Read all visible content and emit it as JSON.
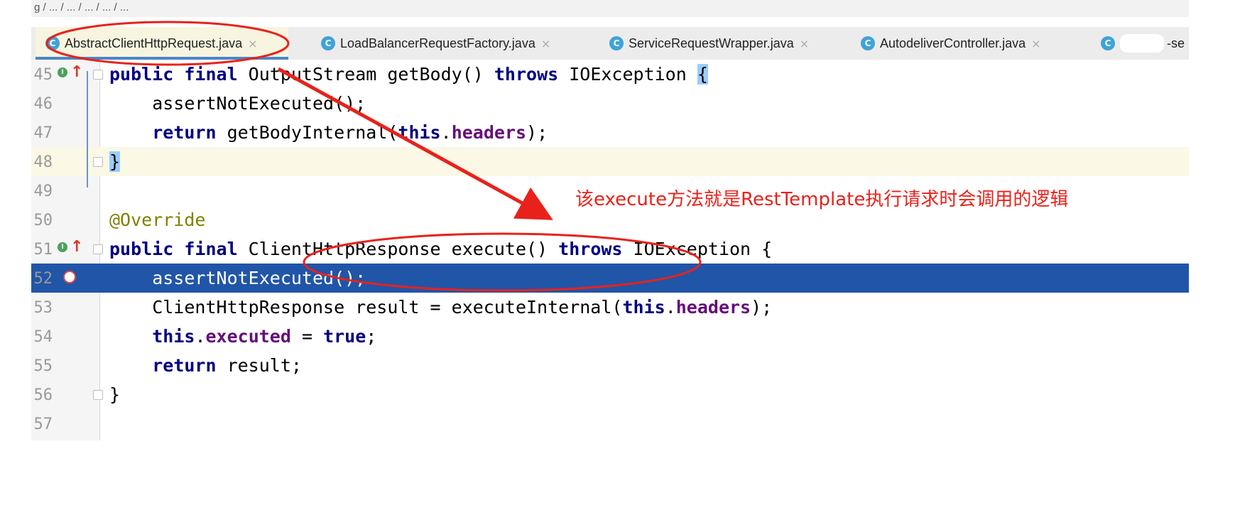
{
  "breadcrumb": {
    "text": "g / ... / ... / ... / ... / ..."
  },
  "tabs": [
    {
      "label": "AbstractClientHttpRequest.java",
      "icon": "C",
      "active": true
    },
    {
      "label": "LoadBalancerRequestFactory.java",
      "icon": "C"
    },
    {
      "label": "ServiceRequestWrapper.java",
      "icon": "C"
    },
    {
      "label": "AutodeliverController.java",
      "icon": "C"
    },
    {
      "label": "-se",
      "icon": "C"
    }
  ],
  "tab_close_glyph": "×",
  "gutter_badge": "I",
  "gutter_arrow": "↑",
  "lines": [
    {
      "num": "45",
      "code": [
        "",
        "public final",
        " OutputStream getBody() ",
        "throws",
        " IOException ",
        "{"
      ]
    },
    {
      "num": "46",
      "code": [
        "    assertNotExecuted();"
      ]
    },
    {
      "num": "47",
      "code": [
        "    ",
        "return",
        " getBodyInternal(",
        "this",
        ".",
        "headers",
        ");"
      ]
    },
    {
      "num": "48",
      "code": [
        "}"
      ]
    },
    {
      "num": "49",
      "code": [
        ""
      ]
    },
    {
      "num": "50",
      "code": [
        "@Override"
      ]
    },
    {
      "num": "51",
      "code": [
        "public final",
        " ClientHttpResponse execute() ",
        "throws",
        " IOException {"
      ]
    },
    {
      "num": "52",
      "code": [
        "    assertNotExecuted();"
      ]
    },
    {
      "num": "53",
      "code": [
        "    ClientHttpResponse result = executeInternal(",
        "this",
        ".",
        "headers",
        ");"
      ]
    },
    {
      "num": "54",
      "code": [
        "    ",
        "this",
        ".",
        "executed",
        " = ",
        "true",
        ";"
      ]
    },
    {
      "num": "55",
      "code": [
        "    ",
        "return",
        " result;"
      ]
    },
    {
      "num": "56",
      "code": [
        "}"
      ]
    },
    {
      "num": "57",
      "code": [
        ""
      ]
    }
  ],
  "annotation": "该execute方法就是RestTemplate执行请求时会调用的逻辑",
  "colors": {
    "keyword": "#000080",
    "field": "#660e7a",
    "annotation_code": "#808000",
    "selection": "#2155a8",
    "caret_line": "#fbf8e5",
    "markup_red": "#e8221b"
  }
}
